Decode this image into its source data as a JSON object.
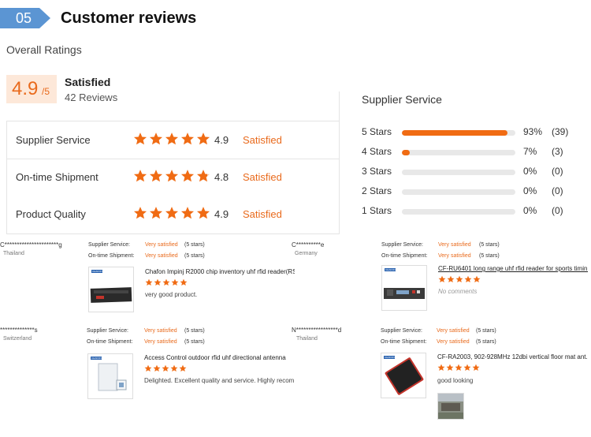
{
  "header": {
    "number": "05",
    "title": "Customer reviews"
  },
  "overall": {
    "heading": "Overall Ratings",
    "score": "4.9",
    "score_suffix": "/5",
    "status": "Satisfied",
    "reviews": "42 Reviews"
  },
  "ratings": [
    {
      "name": "Supplier Service",
      "value": "4.9",
      "status": "Satisfied",
      "stars": 5
    },
    {
      "name": "On-time Shipment",
      "value": "4.8",
      "status": "Satisfied",
      "stars": 4.8
    },
    {
      "name": "Product Quality",
      "value": "4.9",
      "status": "Satisfied",
      "stars": 5
    }
  ],
  "distribution": {
    "title": "Supplier Service",
    "rows": [
      {
        "label": "5 Stars",
        "pct": "93%",
        "count": "(39)",
        "fraction": 0.93
      },
      {
        "label": "4 Stars",
        "pct": "7%",
        "count": "(3)",
        "fraction": 0.07
      },
      {
        "label": "3 Stars",
        "pct": "0%",
        "count": "(0)",
        "fraction": 0
      },
      {
        "label": "2 Stars",
        "pct": "0%",
        "count": "(0)",
        "fraction": 0
      },
      {
        "label": "1 Stars",
        "pct": "0%",
        "count": "(0)",
        "fraction": 0
      }
    ]
  },
  "review_labels": {
    "supplier": "Supplier Service:",
    "shipment": "On-time Shipment:",
    "value": "Very satisfied",
    "stars": "(5 stars)"
  },
  "reviews": [
    {
      "name": "C**********************g",
      "country": "Thailand",
      "product": "Chafon Impinj R2000 chip inventory uhf rfid reader(RS...",
      "comment": "very good product.",
      "thumb_logo": "CHAFON"
    },
    {
      "name": "C**********e",
      "country": "Germany",
      "product": "CF-RU6401 long range uhf rfid reader for sports timin...",
      "comment": "No comments",
      "thumb_logo": "CHAFON"
    },
    {
      "name": "**************s",
      "country": "Switzerland",
      "product": "Access Control outdoor rfid uhf directional antenna",
      "comment": "Delighted. Excellent quality and service. Highly recomr",
      "thumb_logo": "CHAFON"
    },
    {
      "name": "N*****************d",
      "country": "Thailand",
      "product": "CF-RA2003, 902-928MHz 12dbi vertical floor mat ant...",
      "comment": "good looking",
      "thumb_logo": "CHAFON"
    }
  ],
  "colors": {
    "accent": "#f06b13",
    "badge": "#5b95d3",
    "score_bg": "#fde8d9"
  }
}
